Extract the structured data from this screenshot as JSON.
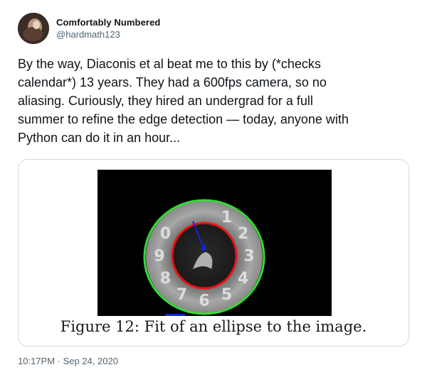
{
  "author": {
    "display_name": "Comfortably Numbered",
    "handle": "@hardmath123",
    "avatar_icon": "avatar-photo-icon"
  },
  "tweet": {
    "lines": [
      "By the way, Diaconis et al beat me to this by (*checks",
      "calendar*) 13 years. They had a 600fps camera, so no",
      "aliasing. Curiously, they hired an undergrad for a full",
      "summer to refine the edge detection — today, anyone with",
      "Python can do it in an hour..."
    ]
  },
  "media": {
    "dial_digits": [
      "1",
      "2",
      "3",
      "4",
      "5",
      "6",
      "7",
      "8",
      "9",
      "0"
    ],
    "caption": "Figure 12: Fit of an ellipse to the image.",
    "colors": {
      "outer_ellipse": "#33dd33",
      "inner_ellipse": "#ee1111",
      "pointer": "#1122dd"
    }
  },
  "meta": {
    "timestamp": "10:17PM · Sep 24, 2020"
  }
}
